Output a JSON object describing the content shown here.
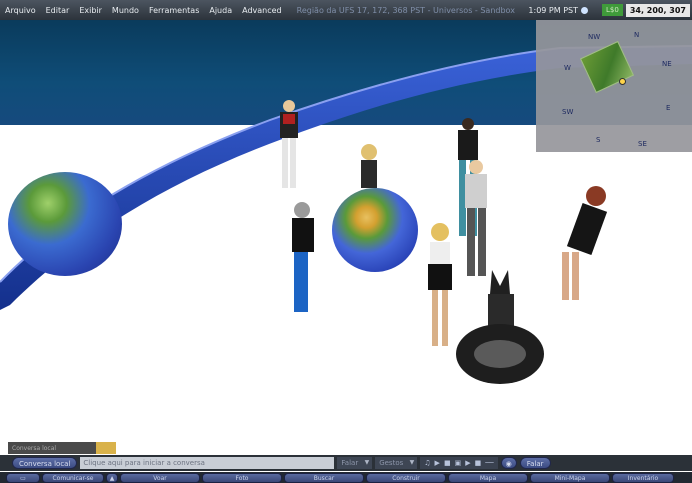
{
  "menu": {
    "items": [
      "Arquivo",
      "Editar",
      "Exibir",
      "Mundo",
      "Ferramentas",
      "Ajuda",
      "Advanced"
    ],
    "region_info": "Região da UFS 17, 172, 368 PST - Universos - Sandbox",
    "clock": "1:09 PM PST",
    "money_badge": "L$0",
    "coordinates": "34, 200, 307"
  },
  "minimap": {
    "labels": {
      "n": "N",
      "nw": "NW",
      "ne": "NE",
      "w": "W",
      "e": "E",
      "sw": "SW",
      "s": "S",
      "se": "SE"
    }
  },
  "chat": {
    "tab_label": "Conversa local",
    "local_chat_button": "Conversa local",
    "input_placeholder": "Clique aqui para iniciar a conversa",
    "say_dropdown": "Falar",
    "gestures_dropdown": "Gestos",
    "speak_button": "Falar"
  },
  "toolbar": {
    "buttons": [
      "Comunicar-se",
      "Voar",
      "Foto",
      "Buscar",
      "Construir",
      "Mapa",
      "Mini-Mapa",
      "Inventário"
    ]
  },
  "colors": {
    "sky": "#0f4d78",
    "wall_blue": "#1f3ea8",
    "menubar": "#3a424b",
    "button": "#4a5a94"
  }
}
